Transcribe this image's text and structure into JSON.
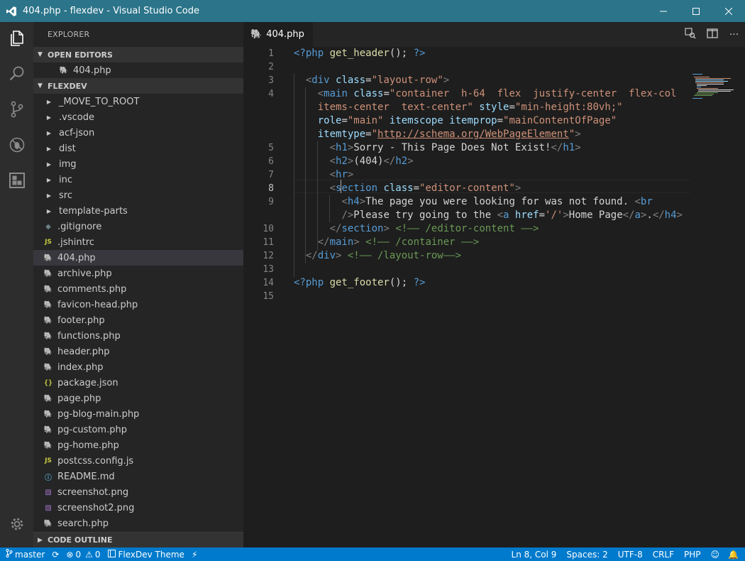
{
  "window": {
    "title": "404.php - flexdev - Visual Studio Code"
  },
  "sidebar": {
    "title": "EXPLORER",
    "open_editors_label": "OPEN EDITORS",
    "open_editors": [
      "404.php"
    ],
    "project_label": "FLEXDEV",
    "folders": [
      "_MOVE_TO_ROOT",
      ".vscode",
      "acf-json",
      "dist",
      "img",
      "inc",
      "src",
      "template-parts"
    ],
    "files": [
      {
        "name": ".gitignore",
        "icon": "git"
      },
      {
        "name": ".jshintrc",
        "icon": "js"
      },
      {
        "name": "404.php",
        "icon": "php"
      },
      {
        "name": "archive.php",
        "icon": "php"
      },
      {
        "name": "comments.php",
        "icon": "php"
      },
      {
        "name": "favicon-head.php",
        "icon": "php"
      },
      {
        "name": "footer.php",
        "icon": "php"
      },
      {
        "name": "functions.php",
        "icon": "php"
      },
      {
        "name": "header.php",
        "icon": "php"
      },
      {
        "name": "index.php",
        "icon": "php"
      },
      {
        "name": "package.json",
        "icon": "json"
      },
      {
        "name": "page.php",
        "icon": "php"
      },
      {
        "name": "pg-blog-main.php",
        "icon": "php"
      },
      {
        "name": "pg-custom.php",
        "icon": "php"
      },
      {
        "name": "pg-home.php",
        "icon": "php"
      },
      {
        "name": "postcss.config.js",
        "icon": "js"
      },
      {
        "name": "README.md",
        "icon": "info"
      },
      {
        "name": "screenshot.png",
        "icon": "img"
      },
      {
        "name": "screenshot2.png",
        "icon": "img"
      },
      {
        "name": "search.php",
        "icon": "php"
      }
    ],
    "outline_label": "CODE OUTLINE"
  },
  "editor": {
    "tab_label": "404.php",
    "cursor_line": 8,
    "lines": [
      {
        "n": "1",
        "tokens": [
          [
            "kw",
            "<?php "
          ],
          [
            "fn",
            "get_header"
          ],
          [
            "plain",
            "(); "
          ],
          [
            "kw",
            "?>"
          ]
        ]
      },
      {
        "n": "2",
        "tokens": []
      },
      {
        "n": "3",
        "tokens": [
          [
            "plain",
            "  "
          ],
          [
            "pun",
            "<"
          ],
          [
            "tag",
            "div "
          ],
          [
            "attr",
            "class"
          ],
          [
            "plain",
            "="
          ],
          [
            "str",
            "\"layout-row\""
          ],
          [
            "pun",
            ">"
          ]
        ]
      },
      {
        "n": "4",
        "tokens": [
          [
            "plain",
            "    "
          ],
          [
            "pun",
            "<"
          ],
          [
            "tag",
            "main "
          ],
          [
            "attr",
            "class"
          ],
          [
            "plain",
            "="
          ],
          [
            "str",
            "\"container  h-64  flex  justify-center  flex-col"
          ]
        ]
      },
      {
        "n": "",
        "tokens": [
          [
            "str",
            "    items-center  text-center\" "
          ],
          [
            "attr",
            "style"
          ],
          [
            "plain",
            "="
          ],
          [
            "str",
            "\"min-height:80vh;\""
          ]
        ]
      },
      {
        "n": "",
        "tokens": [
          [
            "attr",
            "    role"
          ],
          [
            "plain",
            "="
          ],
          [
            "str",
            "\"main\" "
          ],
          [
            "attr",
            "itemscope itemprop"
          ],
          [
            "plain",
            "="
          ],
          [
            "str",
            "\"mainContentOfPage\""
          ]
        ]
      },
      {
        "n": "",
        "tokens": [
          [
            "attr",
            "    itemtype"
          ],
          [
            "plain",
            "="
          ],
          [
            "str",
            "\""
          ],
          [
            "url",
            "http://schema.org/WebPageElement"
          ],
          [
            "str",
            "\""
          ],
          [
            "pun",
            ">"
          ]
        ]
      },
      {
        "n": "5",
        "tokens": [
          [
            "plain",
            "      "
          ],
          [
            "pun",
            "<"
          ],
          [
            "tag",
            "h1"
          ],
          [
            "pun",
            ">"
          ],
          [
            "plain",
            "Sorry - This Page Does Not Exist!"
          ],
          [
            "pun",
            "</"
          ],
          [
            "tag",
            "h1"
          ],
          [
            "pun",
            ">"
          ]
        ]
      },
      {
        "n": "6",
        "tokens": [
          [
            "plain",
            "      "
          ],
          [
            "pun",
            "<"
          ],
          [
            "tag",
            "h2"
          ],
          [
            "pun",
            ">"
          ],
          [
            "plain",
            "(404)"
          ],
          [
            "pun",
            "</"
          ],
          [
            "tag",
            "h2"
          ],
          [
            "pun",
            ">"
          ]
        ]
      },
      {
        "n": "7",
        "tokens": [
          [
            "plain",
            "      "
          ],
          [
            "pun",
            "<"
          ],
          [
            "tag",
            "hr"
          ],
          [
            "pun",
            ">"
          ]
        ]
      },
      {
        "n": "8",
        "tokens": [
          [
            "plain",
            "      "
          ],
          [
            "pun",
            "<"
          ],
          [
            "tag",
            "section "
          ],
          [
            "attr",
            "class"
          ],
          [
            "plain",
            "="
          ],
          [
            "str",
            "\"editor-content\""
          ],
          [
            "pun",
            ">"
          ]
        ]
      },
      {
        "n": "9",
        "tokens": [
          [
            "plain",
            "        "
          ],
          [
            "pun",
            "<"
          ],
          [
            "tag",
            "h4"
          ],
          [
            "pun",
            ">"
          ],
          [
            "plain",
            "The page you were looking for was not found. "
          ],
          [
            "pun",
            "<"
          ],
          [
            "tag",
            "br"
          ]
        ]
      },
      {
        "n": "",
        "tokens": [
          [
            "plain",
            "        "
          ],
          [
            "pun",
            "/>"
          ],
          [
            "plain",
            "Please try going to the "
          ],
          [
            "pun",
            "<"
          ],
          [
            "tag",
            "a "
          ],
          [
            "attr",
            "href"
          ],
          [
            "plain",
            "="
          ],
          [
            "str",
            "'/'"
          ],
          [
            "pun",
            ">"
          ],
          [
            "plain",
            "Home Page"
          ],
          [
            "pun",
            "</"
          ],
          [
            "tag",
            "a"
          ],
          [
            "pun",
            ">"
          ],
          [
            "plain",
            "."
          ],
          [
            "pun",
            "</"
          ],
          [
            "tag",
            "h4"
          ],
          [
            "pun",
            ">"
          ]
        ]
      },
      {
        "n": "10",
        "tokens": [
          [
            "plain",
            "      "
          ],
          [
            "pun",
            "</"
          ],
          [
            "tag",
            "section"
          ],
          [
            "pun",
            "> "
          ],
          [
            "com",
            "<!—— /editor-content ——>"
          ]
        ]
      },
      {
        "n": "11",
        "tokens": [
          [
            "plain",
            "    "
          ],
          [
            "pun",
            "</"
          ],
          [
            "tag",
            "main"
          ],
          [
            "pun",
            "> "
          ],
          [
            "com",
            "<!—— /container ——>"
          ]
        ]
      },
      {
        "n": "12",
        "tokens": [
          [
            "plain",
            "  "
          ],
          [
            "pun",
            "</"
          ],
          [
            "tag",
            "div"
          ],
          [
            "pun",
            "> "
          ],
          [
            "com",
            "<!—— /layout-row——>"
          ]
        ]
      },
      {
        "n": "13",
        "tokens": []
      },
      {
        "n": "14",
        "tokens": [
          [
            "kw",
            "<?php "
          ],
          [
            "fn",
            "get_footer"
          ],
          [
            "plain",
            "(); "
          ],
          [
            "kw",
            "?>"
          ]
        ]
      },
      {
        "n": "15",
        "tokens": []
      }
    ]
  },
  "statusbar": {
    "branch": "master",
    "errors": "0",
    "warnings": "0",
    "theme": "FlexDev Theme",
    "position": "Ln 8, Col 9",
    "spaces": "Spaces: 2",
    "encoding": "UTF-8",
    "eol": "CRLF",
    "language": "PHP"
  },
  "colors": {
    "titlebar": "#2b7489",
    "statusbar": "#007acc",
    "php_icon": "#a074c4"
  }
}
